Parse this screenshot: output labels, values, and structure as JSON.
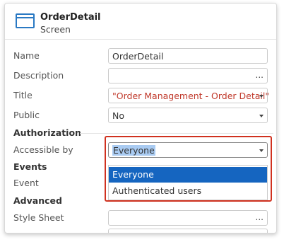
{
  "header": {
    "title": "OrderDetail",
    "subtitle": "Screen",
    "icon": "screen-icon"
  },
  "properties": {
    "name": {
      "label": "Name",
      "value": "OrderDetail"
    },
    "description": {
      "label": "Description",
      "value": "",
      "button": "..."
    },
    "title": {
      "label": "Title",
      "value": "\"Order Management - Order Detail\""
    },
    "public": {
      "label": "Public",
      "value": "No"
    }
  },
  "authorization": {
    "section": "Authorization",
    "accessible_by": {
      "label": "Accessible by",
      "value": "Everyone"
    },
    "dropdown_options": [
      "Everyone",
      "Authenticated users"
    ],
    "selected_index": 0
  },
  "events": {
    "section": "Events",
    "event_label": "Event"
  },
  "advanced": {
    "section": "Advanced",
    "stylesheet": {
      "label": "Style Sheet",
      "button": "..."
    }
  },
  "colors": {
    "accent": "#1565c0",
    "highlight_border": "#d0311f",
    "title_value": "#c0392b",
    "icon": "#2a79c3"
  }
}
